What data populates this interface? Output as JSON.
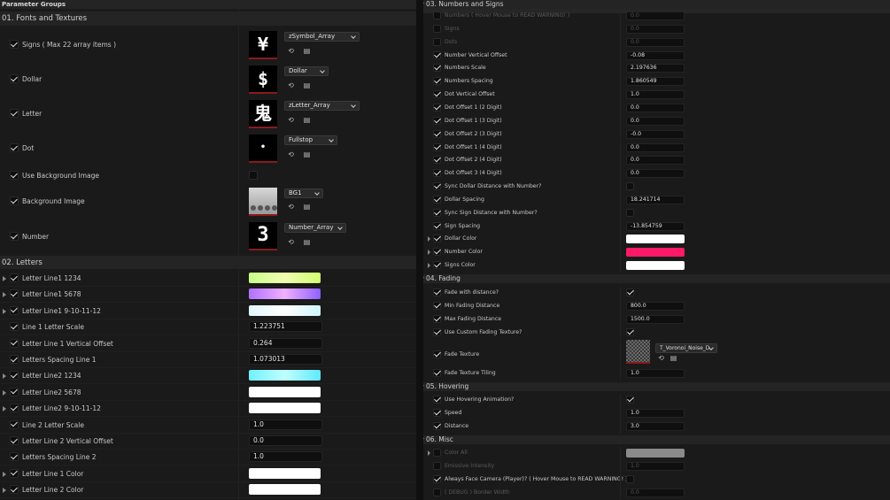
{
  "left": {
    "header": "Parameter Groups",
    "cat1": "01. Fonts and Textures",
    "textures": [
      {
        "label": "Signs ( Max 22 array items )",
        "asset": "zSymbol_Array",
        "glyph": "¥"
      },
      {
        "label": "Dollar",
        "asset": "Dollar",
        "glyph": "$"
      },
      {
        "label": "Letter",
        "asset": "zLetter_Array",
        "glyph": "鬼"
      },
      {
        "label": "Dot",
        "asset": "Fullstop",
        "glyph": "•"
      }
    ],
    "use_bg_label": "Use Background Image",
    "bg": {
      "label": "Background Image",
      "asset": "BG1"
    },
    "number": {
      "label": "Number",
      "asset": "Number_Array",
      "glyph": "3"
    },
    "cat2": "02. Letters",
    "letters": [
      {
        "label": "Letter Line1 1234",
        "kind": "swatch",
        "gradient": "linear-gradient(90deg,#c8ff8a,#f0ffb0,#d0ff70)",
        "expand": true
      },
      {
        "label": "Letter Line1 5678",
        "kind": "swatch",
        "gradient": "linear-gradient(90deg,#b070ff,#f0b0ff,#9060ff)",
        "expand": true
      },
      {
        "label": "Letter Line1 9-10-11-12",
        "kind": "swatch",
        "gradient": "linear-gradient(90deg,#e0f8ff,#ffffff,#d0f4ff)",
        "expand": true
      },
      {
        "label": "Line 1 Letter Scale",
        "kind": "num",
        "value": "1.223751",
        "expand": false
      },
      {
        "label": "Letter Line 1 Vertical Offset",
        "kind": "num",
        "value": "0.264",
        "expand": false
      },
      {
        "label": "Letters Spacing Line 1",
        "kind": "num",
        "value": "1.073013",
        "expand": false
      },
      {
        "label": "Letter Line2 1234",
        "kind": "swatch",
        "gradient": "linear-gradient(90deg,#70f0ff,#c0ffff,#60e8ff)",
        "expand": true
      },
      {
        "label": "Letter Line2 5678",
        "kind": "swatch",
        "gradient": "linear-gradient(90deg,#ffffff,#ffffff)",
        "expand": true
      },
      {
        "label": "Letter Line2 9-10-11-12",
        "kind": "swatch",
        "gradient": "linear-gradient(90deg,#ffffff,#ffffff)",
        "expand": true
      },
      {
        "label": "Line 2 Letter Scale",
        "kind": "num",
        "value": "1.0",
        "expand": false
      },
      {
        "label": "Letter Line 2 Vertical Offset",
        "kind": "num",
        "value": "0.0",
        "expand": false
      },
      {
        "label": "Letters Spacing Line 2",
        "kind": "num",
        "value": "1.0",
        "expand": false
      },
      {
        "label": "Letter Line 1 Color",
        "kind": "swatch",
        "gradient": "linear-gradient(90deg,#ffffff,#ffffff)",
        "expand": true
      },
      {
        "label": "Letter Line 2 Color",
        "kind": "swatch",
        "gradient": "linear-gradient(90deg,#ffffff,#ffffff)",
        "expand": true
      }
    ]
  },
  "right": {
    "cat3": "03. Numbers and Signs",
    "rows3": [
      {
        "label": "Numbers ( Hover Mouse to READ WARNING! )",
        "kind": "num",
        "value": "0.0",
        "checked": false,
        "dim": true
      },
      {
        "label": "Signs",
        "kind": "num",
        "value": "0.0",
        "checked": false,
        "dim": true
      },
      {
        "label": "Dots",
        "kind": "num",
        "value": "0.0",
        "checked": false,
        "dim": true
      },
      {
        "label": "Number Vertical Offset",
        "kind": "num",
        "value": "-0.08",
        "checked": true,
        "hl": true
      },
      {
        "label": "Numbers Scale",
        "kind": "num",
        "value": "2.197636",
        "checked": true
      },
      {
        "label": "Numbers Spacing",
        "kind": "num",
        "value": "1.860549",
        "checked": true
      },
      {
        "label": "Dot Vertical Offset",
        "kind": "num",
        "value": "1.0",
        "checked": true
      },
      {
        "label": "Dot Offset 1 (2 Digit)",
        "kind": "num",
        "value": "0.0",
        "checked": true
      },
      {
        "label": "Dot Offset 1 (3 Digit)",
        "kind": "num",
        "value": "0.0",
        "checked": true
      },
      {
        "label": "Dot Offset 2 (3 Digit)",
        "kind": "num",
        "value": "-0.0",
        "checked": true
      },
      {
        "label": "Dot Offset 1 (4 Digit)",
        "kind": "num",
        "value": "0.0",
        "checked": true
      },
      {
        "label": "Dot Offset 2 (4 Digit)",
        "kind": "num",
        "value": "0.0",
        "checked": true
      },
      {
        "label": "Dot Offset 3 (4 Digit)",
        "kind": "num",
        "value": "0.0",
        "checked": true
      },
      {
        "label": "Sync Dollar Distance with Number?",
        "kind": "bool",
        "value": "",
        "checked": true,
        "bool": false
      },
      {
        "label": "Dollar Spacing",
        "kind": "num",
        "value": "18.241714",
        "checked": true
      },
      {
        "label": "Sync Sign Distance with Number?",
        "kind": "bool",
        "value": "",
        "checked": true,
        "bool": false
      },
      {
        "label": "Sign Spacing",
        "kind": "num",
        "value": "-13.854759",
        "checked": true
      },
      {
        "label": "Dollar Color",
        "kind": "color",
        "color": "#ffffff",
        "checked": true,
        "expand": true
      },
      {
        "label": "Number Color",
        "kind": "color",
        "color": "#ff1a66",
        "checked": true,
        "expand": true
      },
      {
        "label": "Signs Color",
        "kind": "color",
        "color": "#ffffff",
        "checked": true,
        "expand": true
      }
    ],
    "cat4": "04. Fading",
    "rows4": [
      {
        "label": "Fade with distance?",
        "kind": "bool",
        "checked": true,
        "bool": true
      },
      {
        "label": "Min Fading Distance",
        "kind": "num",
        "value": "800.0",
        "checked": true
      },
      {
        "label": "Max Fading Distance",
        "kind": "num",
        "value": "1500.0",
        "checked": true
      },
      {
        "label": "Use Custom Fading Texture?",
        "kind": "bool",
        "checked": true,
        "bool": true
      }
    ],
    "fade_texture": {
      "label": "Fade Texture",
      "asset": "T_Voronoi_Noise_D"
    },
    "fade_tiling": {
      "label": "Fade Texture Tiling",
      "value": "1.0"
    },
    "cat5": "05. Hovering",
    "rows5": [
      {
        "label": "Use Hovering Animation?",
        "kind": "bool",
        "checked": true,
        "bool": true
      },
      {
        "label": "Speed",
        "kind": "num",
        "value": "1.0",
        "checked": true
      },
      {
        "label": "Distance",
        "kind": "num",
        "value": "3.0",
        "checked": true
      }
    ],
    "cat6": "06. Misc",
    "rows6": [
      {
        "label": "Color All",
        "kind": "color",
        "color": "#8a8a8a",
        "checked": false,
        "dim": true,
        "expand": true
      },
      {
        "label": "Emissive Intensity",
        "kind": "num",
        "value": "1.0",
        "checked": false,
        "dim": true
      },
      {
        "label": "Always Face Camera (Player)? ( Hover Mouse to READ WARNING! )",
        "kind": "bool",
        "checked": true,
        "bool": false
      },
      {
        "label": "( DEBUG ) Border Width",
        "kind": "num",
        "value": "0.0",
        "checked": false,
        "dim": true
      }
    ]
  }
}
